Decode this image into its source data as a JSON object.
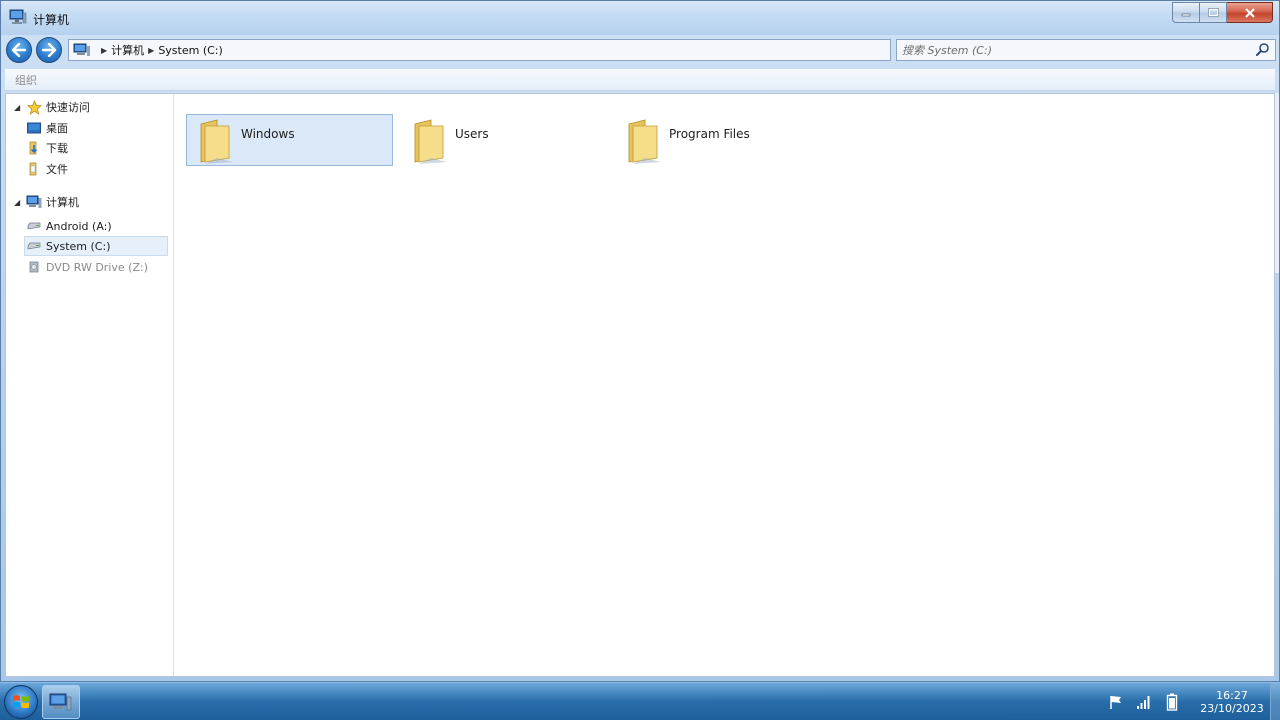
{
  "window": {
    "title": "计算机"
  },
  "address": {
    "crumbs": [
      "计算机",
      "System (C:)"
    ]
  },
  "search": {
    "placeholder": "搜索 System (C:)"
  },
  "command_bar": {
    "organize_label": "组织"
  },
  "nav_pane": {
    "quick_access": {
      "label": "快速访问",
      "items": [
        {
          "label": "桌面",
          "icon": "desktop-icon"
        },
        {
          "label": "下载",
          "icon": "downloads-icon"
        },
        {
          "label": "文件",
          "icon": "documents-icon"
        }
      ]
    },
    "computer": {
      "label": "计算机",
      "drives": [
        {
          "label": "Android (A:)",
          "icon": "drive-icon"
        },
        {
          "label": "System (C:)",
          "icon": "drive-icon"
        },
        {
          "label": "DVD RW Drive (Z:)",
          "icon": "dvd-drive-icon"
        }
      ]
    }
  },
  "files": [
    {
      "name": "Windows",
      "icon": "folder-icon"
    },
    {
      "name": "Users",
      "icon": "folder-icon"
    },
    {
      "name": "Program Files",
      "icon": "folder-icon"
    }
  ],
  "taskbar": {
    "time": "16:27",
    "date": "23/10/2023"
  },
  "colors": {
    "accent": "#2b7ccd",
    "selection": "#dbe8f8",
    "close_button": "#c4442c"
  }
}
